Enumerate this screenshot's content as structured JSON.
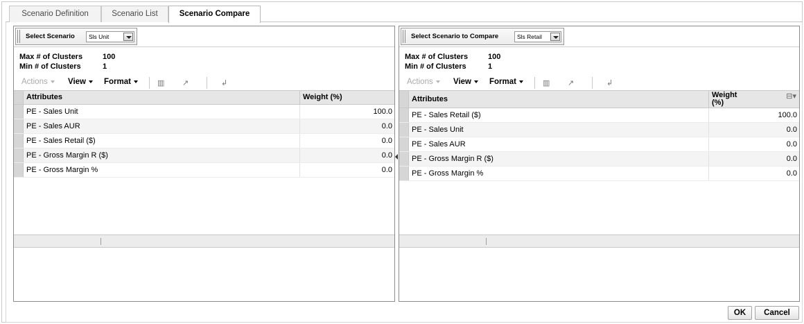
{
  "tabs": [
    {
      "label": "Scenario Definition",
      "active": false
    },
    {
      "label": "Scenario List",
      "active": false
    },
    {
      "label": "Scenario Compare",
      "active": true
    }
  ],
  "left_panel": {
    "select_label": "Select Scenario",
    "select_value": "Sls Unit",
    "max_clusters_label": "Max # of Clusters",
    "max_clusters_value": "100",
    "min_clusters_label": "Min # of Clusters",
    "min_clusters_value": "1",
    "toolbar": {
      "actions": "Actions",
      "view": "View",
      "format": "Format"
    },
    "columns": {
      "attributes": "Attributes",
      "weight": "Weight (%)"
    },
    "rows": [
      {
        "attribute": "PE - Sales Unit",
        "weight": "100.0"
      },
      {
        "attribute": "PE - Sales AUR",
        "weight": "0.0"
      },
      {
        "attribute": "PE - Sales Retail ($)",
        "weight": "0.0"
      },
      {
        "attribute": "PE - Gross Margin R ($)",
        "weight": "0.0"
      },
      {
        "attribute": "PE - Gross Margin %",
        "weight": "0.0"
      }
    ]
  },
  "right_panel": {
    "select_label": "Select Scenario to Compare",
    "select_value": "Sls Retail",
    "max_clusters_label": "Max # of Clusters",
    "max_clusters_value": "100",
    "min_clusters_label": "Min # of Clusters",
    "min_clusters_value": "1",
    "toolbar": {
      "actions": "Actions",
      "view": "View",
      "format": "Format"
    },
    "columns": {
      "attributes": "Attributes",
      "weight_line1": "Weight",
      "weight_line2": "(%)"
    },
    "rows": [
      {
        "attribute": "PE - Sales Retail ($)",
        "weight": "100.0"
      },
      {
        "attribute": "PE - Sales Unit",
        "weight": "0.0"
      },
      {
        "attribute": "PE - Sales AUR",
        "weight": "0.0"
      },
      {
        "attribute": "PE - Gross Margin R ($)",
        "weight": "0.0"
      },
      {
        "attribute": "PE - Gross Margin %",
        "weight": "0.0"
      }
    ]
  },
  "buttons": {
    "ok": "OK",
    "cancel": "Cancel"
  },
  "icons": [
    "freeze-columns-icon",
    "detach-icon",
    "wrap-icon",
    "column-menu-icon",
    "dropdown-arrow-icon",
    "splitter-collapse-icon"
  ]
}
